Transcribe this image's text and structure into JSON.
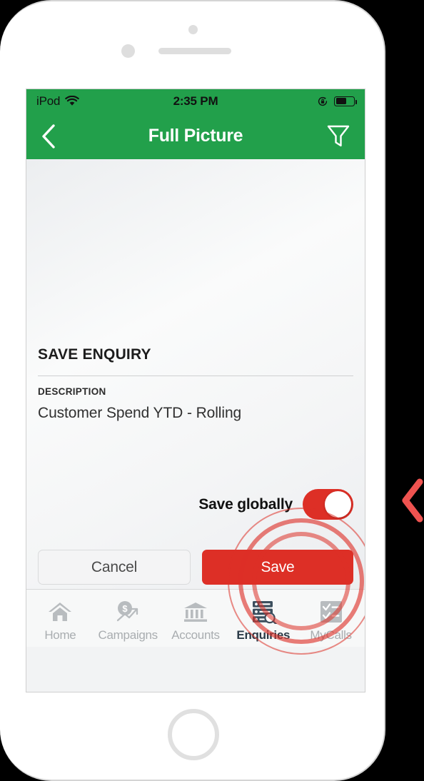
{
  "device": {
    "frame": "iphone-white",
    "sensor_icon": "proximity-sensor",
    "camera_icon": "front-camera",
    "speaker_icon": "earpiece-speaker",
    "home_button_icon": "home-button"
  },
  "status_bar": {
    "carrier": "iPod",
    "wifi_icon": "wifi-icon",
    "time": "2:35 PM",
    "rotation_lock_icon": "rotation-lock-icon",
    "battery_icon": "battery-icon",
    "battery_level_percent": 62
  },
  "nav_bar": {
    "back_icon": "chevron-left-icon",
    "title": "Full Picture",
    "filter_icon": "filter-funnel-icon",
    "background_color": "#22a04b"
  },
  "form": {
    "title": "SAVE ENQUIRY",
    "description_label": "DESCRIPTION",
    "description_value": "Customer Spend YTD - Rolling",
    "toggle_label": "Save globally",
    "toggle_state": "on",
    "cancel_label": "Cancel",
    "save_label": "Save",
    "accent_color": "#dd2f26"
  },
  "interaction": {
    "tap_indicator": "tap-ripple",
    "target": "Save"
  },
  "tab_bar": {
    "items": [
      {
        "label": "Home",
        "icon": "home-icon",
        "active": false
      },
      {
        "label": "Campaigns",
        "icon": "campaigns-icon",
        "active": false
      },
      {
        "label": "Accounts",
        "icon": "accounts-icon",
        "active": false
      },
      {
        "label": "Enquiries",
        "icon": "enquiries-icon",
        "active": true
      },
      {
        "label": "MyCalls",
        "icon": "mycalls-icon",
        "active": false
      }
    ]
  },
  "navigation": {
    "prev_arrow_icon": "chevron-left-icon",
    "prev_arrow_color": "#ef5350"
  }
}
